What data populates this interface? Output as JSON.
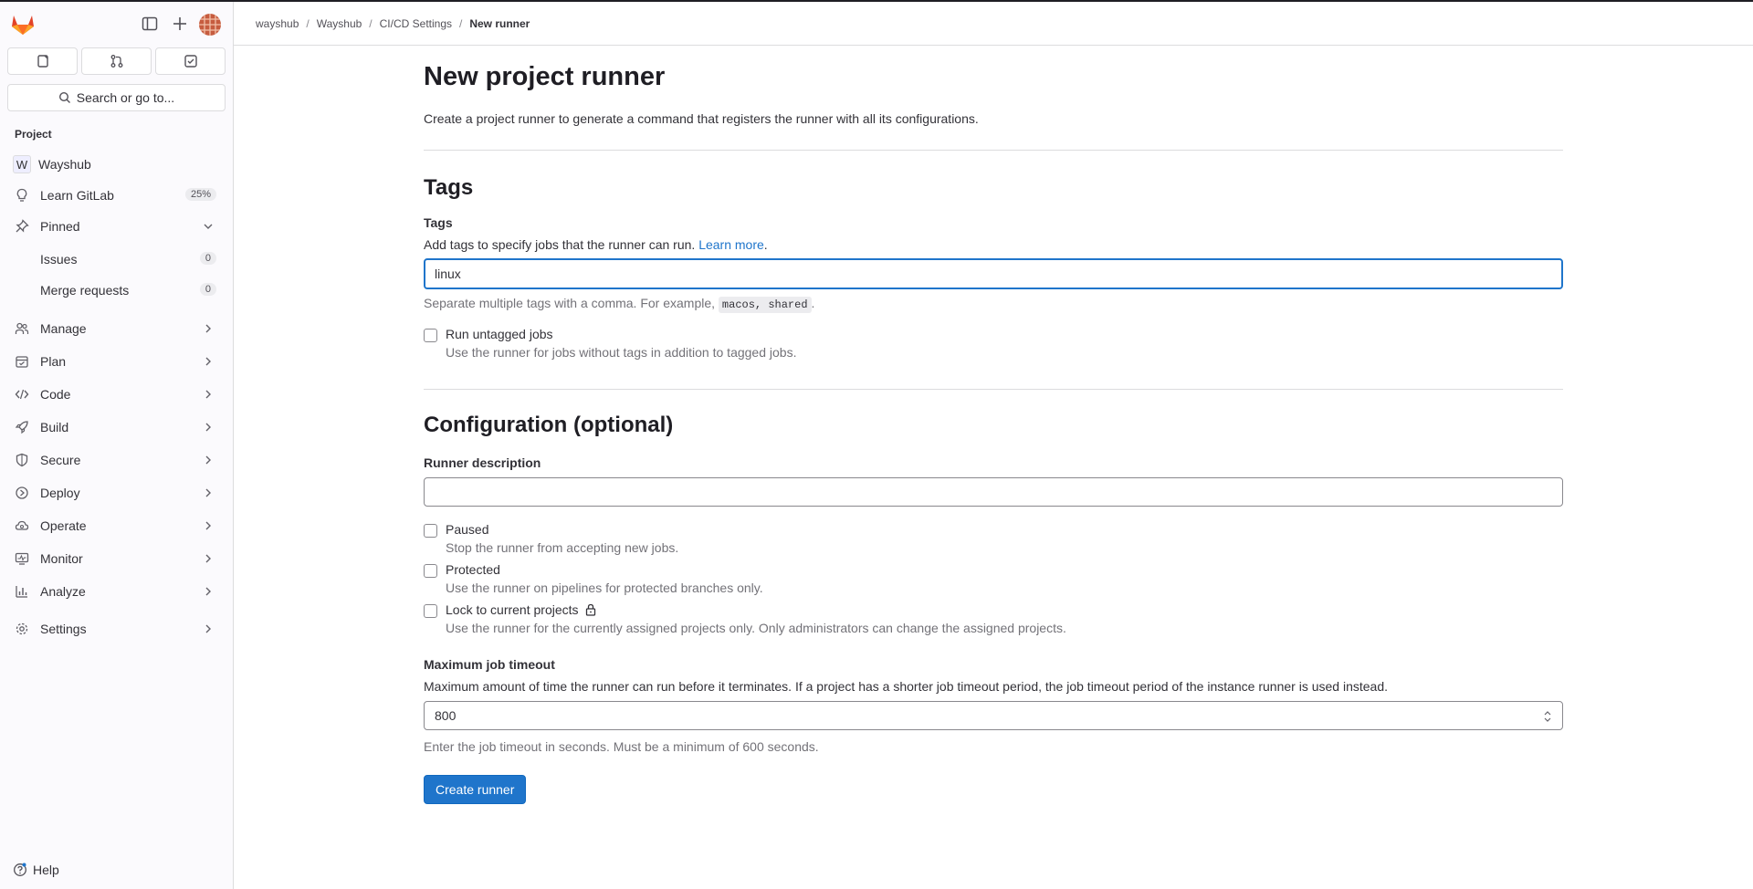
{
  "sidebar": {
    "search_label": "Search or go to...",
    "section_label": "Project",
    "project": {
      "initial": "W",
      "name": "Wayshub"
    },
    "learn": {
      "label": "Learn GitLab",
      "badge": "25%"
    },
    "pinned": {
      "label": "Pinned",
      "items": [
        {
          "label": "Issues",
          "count": "0"
        },
        {
          "label": "Merge requests",
          "count": "0"
        }
      ]
    },
    "menu": [
      {
        "label": "Manage",
        "icon": "users-icon"
      },
      {
        "label": "Plan",
        "icon": "planning-icon"
      },
      {
        "label": "Code",
        "icon": "code-icon"
      },
      {
        "label": "Build",
        "icon": "rocket-icon"
      },
      {
        "label": "Secure",
        "icon": "shield-icon"
      },
      {
        "label": "Deploy",
        "icon": "deployments-icon"
      },
      {
        "label": "Operate",
        "icon": "cloud-icon"
      },
      {
        "label": "Monitor",
        "icon": "monitor-icon"
      },
      {
        "label": "Analyze",
        "icon": "chart-icon"
      },
      {
        "label": "Settings",
        "icon": "gear-icon"
      }
    ],
    "help_label": "Help"
  },
  "breadcrumb": [
    "wayshub",
    "Wayshub",
    "CI/CD Settings",
    "New runner"
  ],
  "page": {
    "title": "New project runner",
    "intro": "Create a project runner to generate a command that registers the runner with all its configurations."
  },
  "tags": {
    "heading": "Tags",
    "label": "Tags",
    "description": "Add tags to specify jobs that the runner can run.",
    "learn_more": "Learn more",
    "value": "linux",
    "help_prefix": "Separate multiple tags with a comma. For example,",
    "help_code": "macos, shared",
    "run_untagged": {
      "label": "Run untagged jobs",
      "help": "Use the runner for jobs without tags in addition to tagged jobs.",
      "checked": false
    }
  },
  "config": {
    "heading": "Configuration (optional)",
    "description_label": "Runner description",
    "description_value": "",
    "paused": {
      "label": "Paused",
      "help": "Stop the runner from accepting new jobs.",
      "checked": false
    },
    "protected": {
      "label": "Protected",
      "help": "Use the runner on pipelines for protected branches only.",
      "checked": false
    },
    "locked": {
      "label": "Lock to current projects",
      "help": "Use the runner for the currently assigned projects only. Only administrators can change the assigned projects.",
      "checked": false
    },
    "timeout_label": "Maximum job timeout",
    "timeout_desc": "Maximum amount of time the runner can run before it terminates. If a project has a shorter job timeout period, the job timeout period of the instance runner is used instead.",
    "timeout_value": "800",
    "timeout_help": "Enter the job timeout in seconds. Must be a minimum of 600 seconds."
  },
  "submit_label": "Create runner",
  "colors": {
    "primary": "#1f75cb",
    "focus": "#1f75cb",
    "brand": "#e24329"
  }
}
